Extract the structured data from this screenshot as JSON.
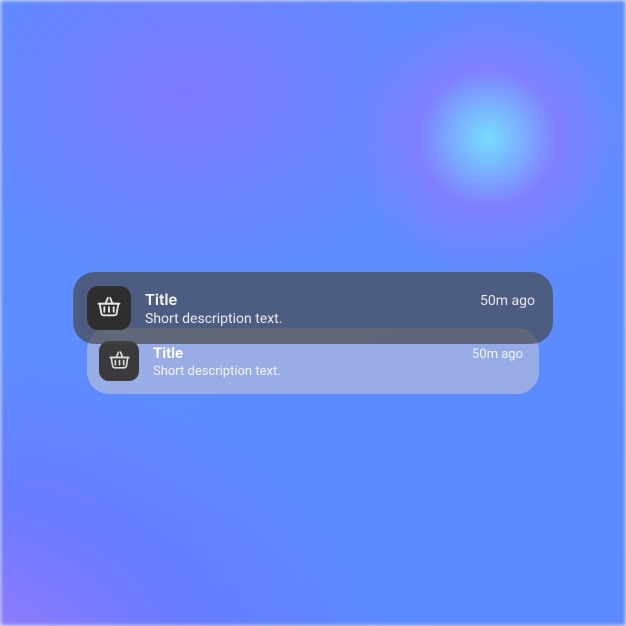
{
  "notifications": [
    {
      "icon": "shopping-basket",
      "title": "Title",
      "description": "Short description text.",
      "time": "50m ago"
    },
    {
      "icon": "shopping-basket",
      "title": "Title",
      "description": "Short description text.",
      "time": "50m ago"
    }
  ]
}
